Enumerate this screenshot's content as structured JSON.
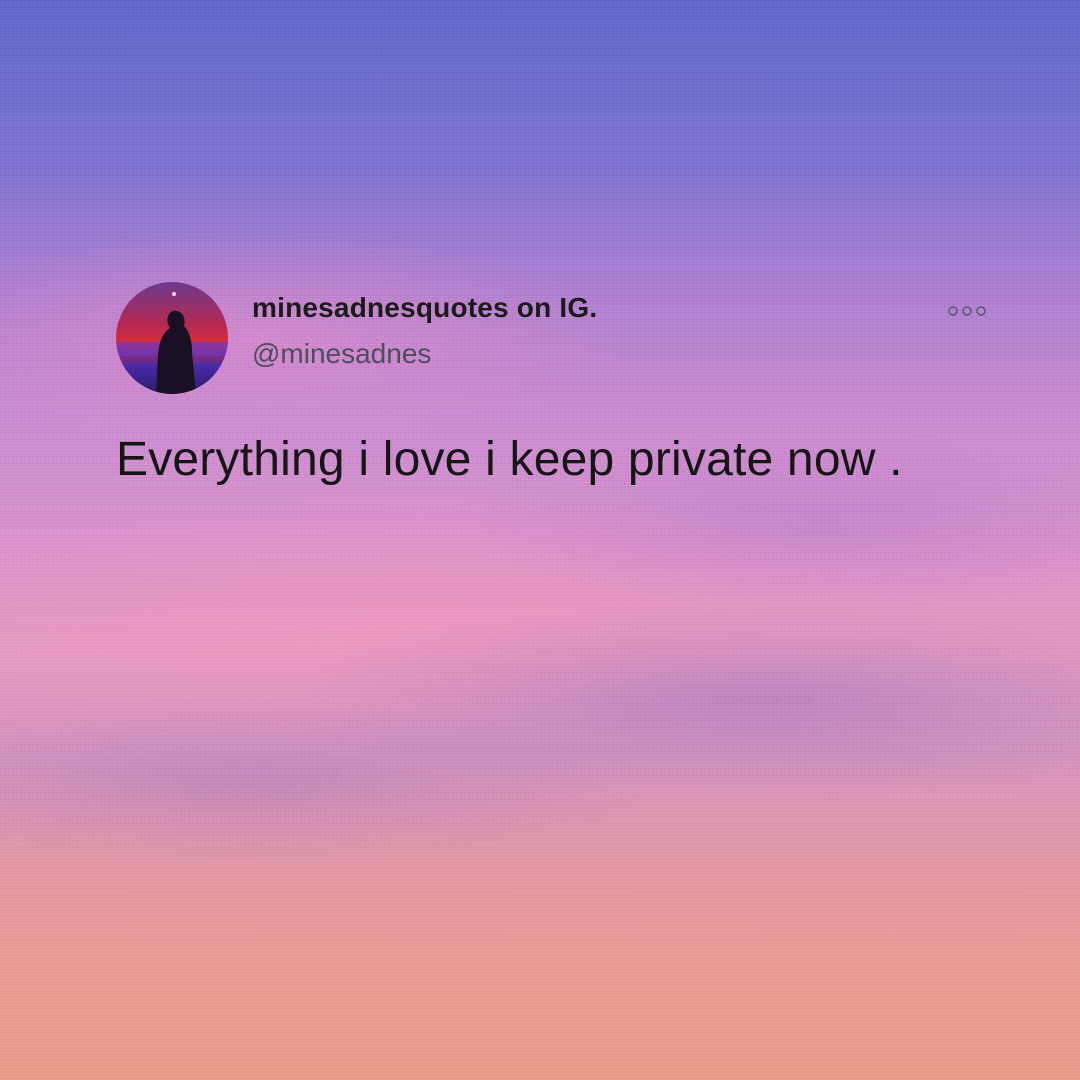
{
  "post": {
    "display_name": "minesadnesquotes on IG.",
    "handle": "@minesadnes",
    "text": "Everything i love i keep private now .",
    "avatar_icon": "profile-silhouette-avatar",
    "more_icon": "more-options-icon"
  },
  "colors": {
    "text_primary": "#161616",
    "text_secondary": "#4d4d5e",
    "sky_top": "#5f67c9",
    "sky_bottom": "#e99a88"
  }
}
